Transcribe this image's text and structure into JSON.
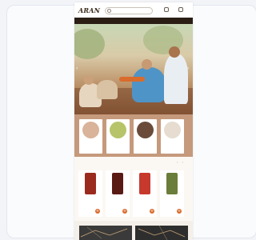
{
  "header": {
    "logo": "ARAN",
    "search_placeholder": "",
    "icons": [
      "user-icon",
      "cart-icon"
    ],
    "icon_labels": [
      "",
      ""
    ]
  },
  "nav": {
    "items": [
      "",
      "",
      "",
      "",
      "",
      ""
    ]
  },
  "hero": {
    "title": "",
    "cta": ""
  },
  "categories": [
    {
      "label": "",
      "color": "#d9b39a"
    },
    {
      "label": "",
      "color": "#b7c46a"
    },
    {
      "label": "",
      "color": "#6a4b3a"
    },
    {
      "label": "",
      "color": "#e6dcd0"
    }
  ],
  "products_section": {
    "title": "",
    "items": [
      {
        "name": "",
        "price": "",
        "color": "#9b2a1e"
      },
      {
        "name": "",
        "price": "",
        "color": "#5a1a14"
      },
      {
        "name": "",
        "price": "",
        "color": "#c7392c"
      },
      {
        "name": "",
        "price": "",
        "color": "#6b7d3a"
      }
    ]
  },
  "colors": {
    "accent": "#d96b2c",
    "nav_bg": "#2a1d14",
    "category_band": "#c5997c"
  }
}
